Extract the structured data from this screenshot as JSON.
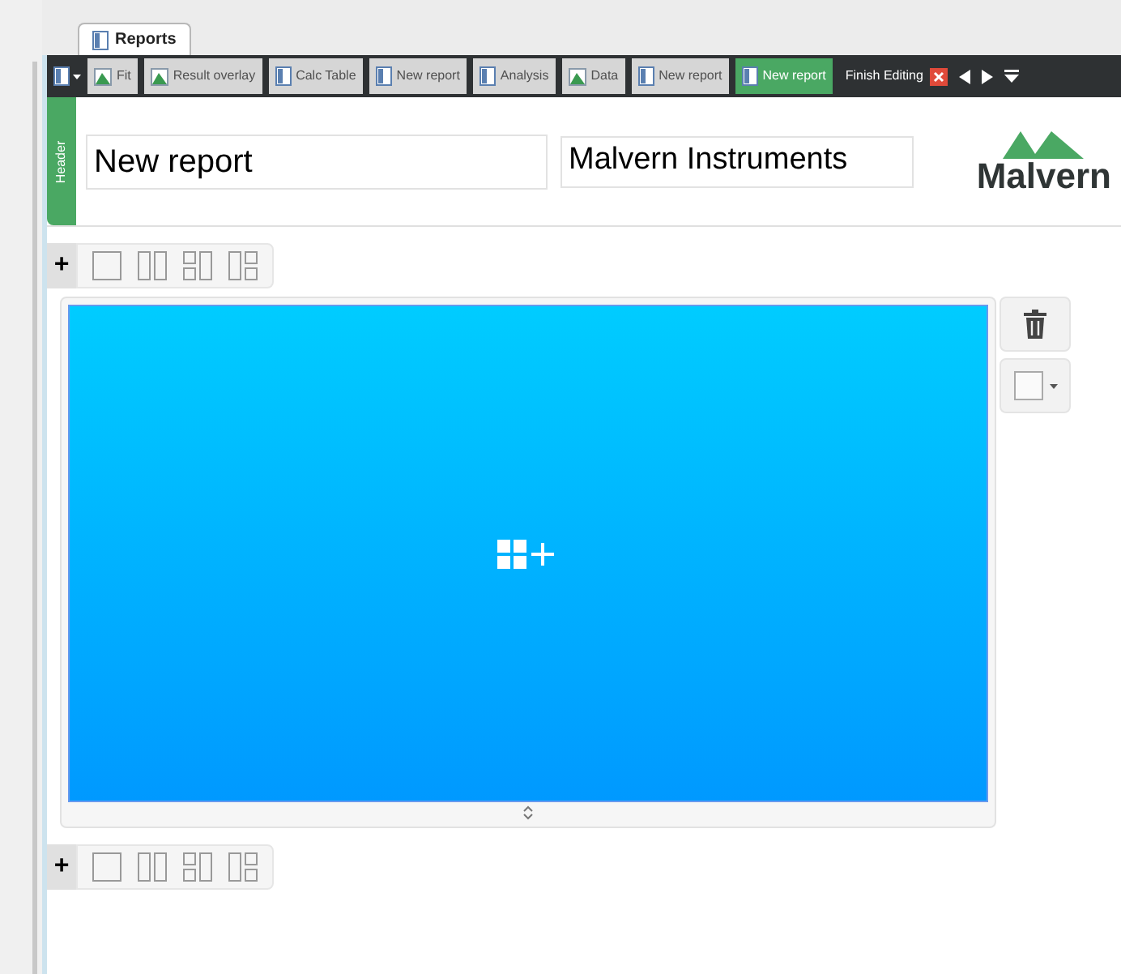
{
  "window_tab": {
    "title": "Reports"
  },
  "tabs": [
    {
      "label": "Fit",
      "kind": "chart",
      "selected": false
    },
    {
      "label": "Result overlay",
      "kind": "chart",
      "selected": false
    },
    {
      "label": "Calc Table",
      "kind": "doc",
      "selected": false
    },
    {
      "label": "New report",
      "kind": "doc",
      "selected": false
    },
    {
      "label": "Analysis",
      "kind": "doc",
      "selected": false
    },
    {
      "label": "Data",
      "kind": "chart",
      "selected": false
    },
    {
      "label": "New report",
      "kind": "doc",
      "selected": false
    },
    {
      "label": "New report",
      "kind": "doc",
      "selected": true
    }
  ],
  "finish_editing": "Finish Editing",
  "header": {
    "side_label": "Header",
    "title": "New report",
    "company": "Malvern Instruments",
    "logo_text": "Malvern"
  },
  "layout_toolbars": [
    {
      "add": "+"
    },
    {
      "add": "+"
    }
  ]
}
